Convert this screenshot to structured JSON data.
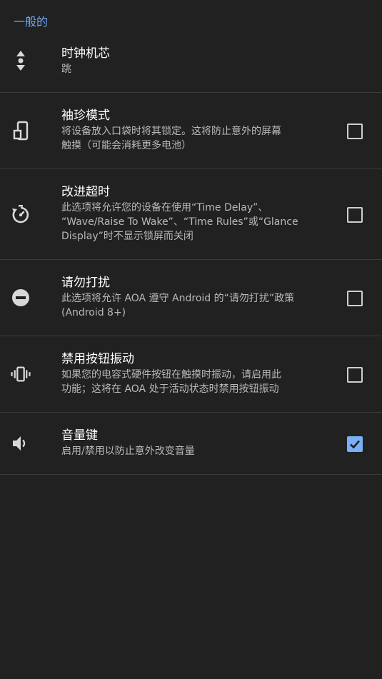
{
  "section": {
    "title": "一般的"
  },
  "settings": [
    {
      "title": "时钟机芯",
      "summary": "跳",
      "icon": "vertical-move-icon"
    },
    {
      "title": "袖珍模式",
      "summary": "将设备放入口袋时将其锁定。这将防止意外的屏幕\n触摸（可能会消耗更多电池）",
      "icon": "pocket-phone-icon",
      "checked": false
    },
    {
      "title": "改进超时",
      "summary": "此选项将允许您的设备在使用“Time Delay”、\n“Wave/Raise To Wake”、“Time Rules”或“Glance\nDisplay”时不显示锁屏而关闭",
      "icon": "timer-icon",
      "checked": false
    },
    {
      "title": "请勿打扰",
      "summary": "此选项将允许 AOA 遵守 Android 的“请勿打扰”政策\n(Android 8+)",
      "icon": "do-not-disturb-icon",
      "checked": false
    },
    {
      "title": "禁用按钮振动",
      "summary": "如果您的电容式硬件按钮在触摸时振动，请启用此\n功能；这将在 AOA 处于活动状态时禁用按钮振动",
      "icon": "vibration-icon",
      "checked": false
    },
    {
      "title": "音量键",
      "summary": "启用/禁用以防止意外改变音量",
      "icon": "volume-icon",
      "checked": true
    }
  ],
  "colors": {
    "background": "#212121",
    "accent": "#6ea8f5",
    "checkbox_checked": "#7aaef5",
    "divider": "#3a3a3a"
  }
}
